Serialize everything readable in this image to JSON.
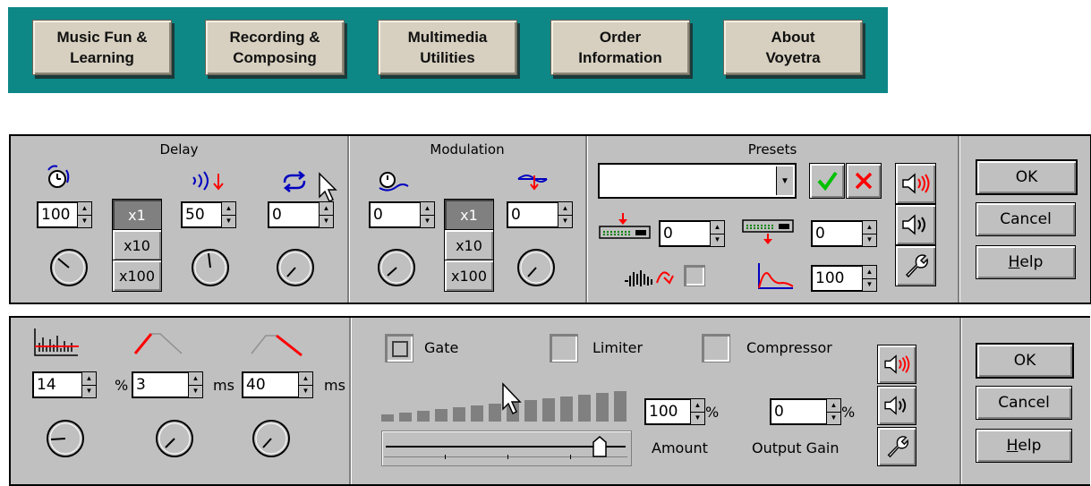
{
  "nav": {
    "buttons": [
      "Music Fun &\nLearning",
      "Recording &\nComposing",
      "Multimedia\nUtilities",
      "Order\nInformation",
      "About\nVoyetra"
    ]
  },
  "panel1": {
    "delay": {
      "title": "Delay",
      "time_value": "100",
      "feedback_value": "50",
      "repeat_value": "0",
      "multipliers": [
        "x1",
        "x10",
        "x100"
      ],
      "selected_multiplier": "x1"
    },
    "modulation": {
      "title": "Modulation",
      "rate_value": "0",
      "depth_value": "0",
      "multipliers": [
        "x1",
        "x10",
        "x100"
      ],
      "selected_multiplier": "x1"
    },
    "presets": {
      "title": "Presets",
      "preset_value": "",
      "input_level": "0",
      "output_level": "0",
      "mix_value": "100"
    },
    "buttons": {
      "ok": "OK",
      "cancel": "Cancel",
      "help_h": "H",
      "help_rest": "elp"
    }
  },
  "panel2": {
    "spin1": "14",
    "unit1": "%",
    "spin2": "3",
    "unit2": "ms",
    "spin3": "40",
    "unit3": "ms",
    "gate_label": "Gate",
    "limiter_label": "Limiter",
    "compressor_label": "Compressor",
    "amount_value": "100",
    "amount_unit": "%",
    "amount_label": "Amount",
    "output_gain_value": "0",
    "output_gain_unit": "%",
    "output_gain_label": "Output Gain",
    "slider_level": 0.92,
    "buttons": {
      "ok": "OK",
      "cancel": "Cancel",
      "help_h": "H",
      "help_rest": "elp"
    }
  },
  "icons": {
    "speaker_effect": "speaker-effect-icon",
    "speaker": "speaker-icon",
    "wrench": "wrench-icon",
    "accept": "check-icon",
    "reject": "x-icon"
  },
  "colors": {
    "nav_bg": "#0e8787",
    "panel_bg": "#c0c0c0",
    "accent_red": "#ff0000",
    "accept_green": "#00c000",
    "icon_blue": "#0000c0"
  }
}
